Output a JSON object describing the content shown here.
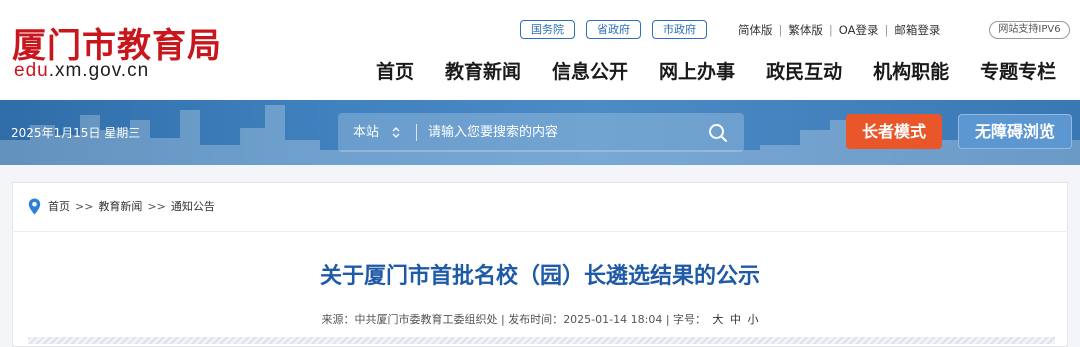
{
  "header": {
    "logo_title": "厦门市教育局",
    "logo_domain_prefix": "edu",
    "logo_domain_rest": ".xm.gov.cn",
    "gov_links": [
      "国务院",
      "省政府",
      "市政府"
    ],
    "util_links": [
      "简体版",
      "繁体版",
      "OA登录",
      "邮箱登录"
    ],
    "ipv6_badge": "网站支持IPV6",
    "nav": [
      "首页",
      "教育新闻",
      "信息公开",
      "网上办事",
      "政民互动",
      "机构职能",
      "专题专栏"
    ]
  },
  "banner": {
    "date": "2025年1月15日 星期三",
    "search": {
      "scope": "本站",
      "placeholder": "请输入您要搜索的内容"
    },
    "elder_mode": "长者模式",
    "accessible": "无障碍浏览"
  },
  "breadcrumb": {
    "items": [
      "首页",
      "教育新闻",
      "通知公告"
    ],
    "separator": ">>"
  },
  "article": {
    "title": "关于厦门市首批名校（园）长遴选结果的公示",
    "source_label": "来源：",
    "source": "中共厦门市委教育工委组织处",
    "time_label": "发布时间：",
    "time": "2025-01-14 18:04",
    "fontsize_label": "字号：",
    "sizes": [
      "大",
      "中",
      "小"
    ]
  },
  "colors": {
    "brand_red": "#c8161d",
    "link_blue": "#2e6fb8",
    "title_blue": "#1f5aa6",
    "elder_orange": "#e8562a",
    "banner_blue": "#3e80bd"
  },
  "icons": [
    "location-pin-icon",
    "search-icon",
    "sort-arrows-icon"
  ]
}
